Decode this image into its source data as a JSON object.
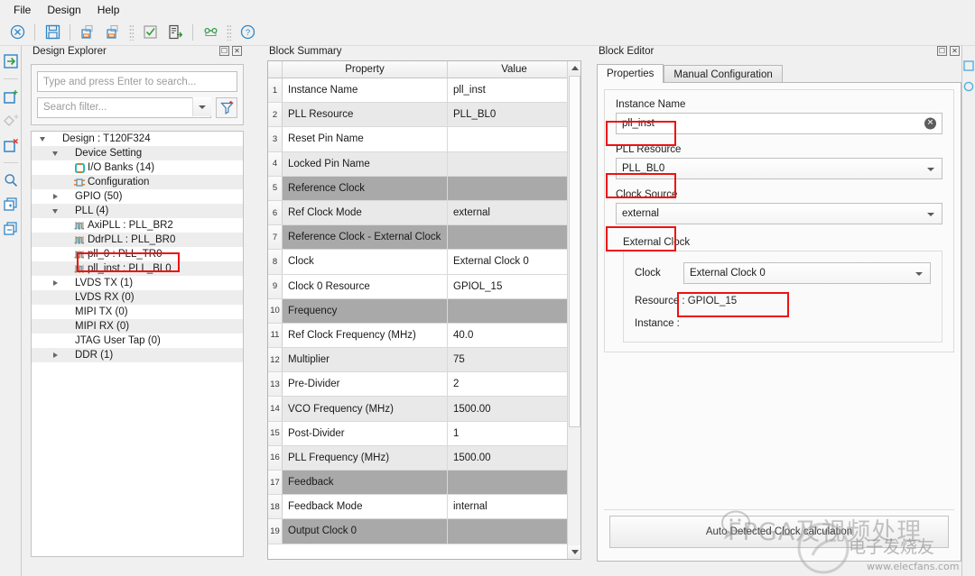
{
  "menubar": {
    "items": [
      "File",
      "Design",
      "Help"
    ]
  },
  "toolbar": {
    "buttons": [
      {
        "name": "close-design-icon",
        "glyph": "cancel"
      },
      {
        "name": "save-icon",
        "glyph": "save"
      },
      {
        "name": "import-design-icon",
        "glyph": "import"
      },
      {
        "name": "export-design-icon",
        "glyph": "export"
      },
      {
        "name": "check-design-icon",
        "glyph": "check"
      },
      {
        "name": "generate-report-icon",
        "glyph": "report"
      },
      {
        "name": "link-icon",
        "glyph": "link"
      },
      {
        "name": "help-icon",
        "glyph": "help"
      }
    ]
  },
  "rail": {
    "buttons": [
      {
        "name": "add-input-icon"
      },
      {
        "name": "add-block-icon"
      },
      {
        "name": "add-diamond-icon"
      },
      {
        "name": "remove-block-icon"
      },
      {
        "name": "search-icon"
      },
      {
        "name": "duplicate-add-icon"
      },
      {
        "name": "duplicate-icon"
      }
    ]
  },
  "explorer": {
    "title": "Design Explorer",
    "search_placeholder": "Type and press Enter to search...",
    "filter_placeholder": "Search filter...",
    "tree": [
      {
        "label": "Design : T120F324",
        "indent": 0,
        "twisty": "down",
        "icon": "none",
        "alt": false
      },
      {
        "label": "Device Setting",
        "indent": 1,
        "twisty": "down",
        "icon": "none",
        "alt": true
      },
      {
        "label": "I/O Banks (14)",
        "indent": 2,
        "twisty": "none",
        "icon": "iobank",
        "alt": false
      },
      {
        "label": "Configuration",
        "indent": 2,
        "twisty": "none",
        "icon": "config",
        "alt": true
      },
      {
        "label": "GPIO (50)",
        "indent": 1,
        "twisty": "right",
        "icon": "none",
        "alt": false
      },
      {
        "label": "PLL (4)",
        "indent": 1,
        "twisty": "down",
        "icon": "none",
        "alt": true
      },
      {
        "label": "AxiPLL : PLL_BR2",
        "indent": 2,
        "twisty": "none",
        "icon": "pll",
        "alt": false
      },
      {
        "label": "DdrPLL : PLL_BR0",
        "indent": 2,
        "twisty": "none",
        "icon": "pll",
        "alt": true
      },
      {
        "label": "pll_0 : PLL_TR0",
        "indent": 2,
        "twisty": "none",
        "icon": "pll",
        "alt": false
      },
      {
        "label": "pll_inst : PLL_BL0",
        "indent": 2,
        "twisty": "none",
        "icon": "pll",
        "alt": true
      },
      {
        "label": "LVDS TX (1)",
        "indent": 1,
        "twisty": "right",
        "icon": "none",
        "alt": false
      },
      {
        "label": "LVDS RX (0)",
        "indent": 1,
        "twisty": "none",
        "icon": "none",
        "alt": true
      },
      {
        "label": "MIPI TX (0)",
        "indent": 1,
        "twisty": "none",
        "icon": "none",
        "alt": false
      },
      {
        "label": "MIPI RX (0)",
        "indent": 1,
        "twisty": "none",
        "icon": "none",
        "alt": true
      },
      {
        "label": "JTAG User Tap (0)",
        "indent": 1,
        "twisty": "none",
        "icon": "none",
        "alt": false
      },
      {
        "label": "DDR (1)",
        "indent": 1,
        "twisty": "right",
        "icon": "none",
        "alt": true
      }
    ]
  },
  "summary": {
    "title": "Block Summary",
    "columns": [
      "",
      "Property",
      "Value"
    ],
    "rows": [
      {
        "n": "1",
        "property": "Instance Name",
        "value": "pll_inst",
        "style": "white"
      },
      {
        "n": "2",
        "property": "PLL Resource",
        "value": "PLL_BL0",
        "style": "light"
      },
      {
        "n": "3",
        "property": "Reset Pin Name",
        "value": "",
        "style": "white"
      },
      {
        "n": "4",
        "property": "Locked Pin Name",
        "value": "",
        "style": "light"
      },
      {
        "n": "5",
        "property": "Reference Clock",
        "value": "",
        "style": "dark"
      },
      {
        "n": "6",
        "property": "Ref Clock Mode",
        "value": "external",
        "style": "light"
      },
      {
        "n": "7",
        "property": "Reference Clock - External Clock",
        "value": "",
        "style": "dark"
      },
      {
        "n": "8",
        "property": "Clock",
        "value": "External Clock 0",
        "style": "white"
      },
      {
        "n": "9",
        "property": "Clock 0 Resource",
        "value": "GPIOL_15",
        "style": "white"
      },
      {
        "n": "10",
        "property": "Frequency",
        "value": "",
        "style": "dark"
      },
      {
        "n": "11",
        "property": "Ref Clock Frequency (MHz)",
        "value": "40.0",
        "style": "white"
      },
      {
        "n": "12",
        "property": "Multiplier",
        "value": "75",
        "style": "light"
      },
      {
        "n": "13",
        "property": "Pre-Divider",
        "value": "2",
        "style": "white"
      },
      {
        "n": "14",
        "property": "VCO Frequency (MHz)",
        "value": "1500.00",
        "style": "light"
      },
      {
        "n": "15",
        "property": "Post-Divider",
        "value": "1",
        "style": "white"
      },
      {
        "n": "16",
        "property": "PLL Frequency (MHz)",
        "value": "1500.00",
        "style": "light"
      },
      {
        "n": "17",
        "property": "Feedback",
        "value": "",
        "style": "dark"
      },
      {
        "n": "18",
        "property": "Feedback Mode",
        "value": "internal",
        "style": "white"
      },
      {
        "n": "19",
        "property": "Output Clock 0",
        "value": "",
        "style": "dark"
      }
    ]
  },
  "editor": {
    "title": "Block Editor",
    "tabs": [
      {
        "label": "Properties",
        "active": true
      },
      {
        "label": "Manual Configuration",
        "active": false
      }
    ],
    "instance_name_label": "Instance Name",
    "instance_name_value": "pll_inst",
    "pll_resource_label": "PLL Resource",
    "pll_resource_value": "PLL_BL0",
    "clock_source_label": "Clock Source",
    "clock_source_value": "external",
    "external_clock_legend": "External Clock",
    "clock_label": "Clock",
    "clock_value": "External Clock 0",
    "resource_line": "Resource :  GPIOL_15",
    "instance_line": "Instance :",
    "calculate_button": "Auto Detected Clock calculation"
  },
  "watermark": {
    "chinese": "FPGA及视频处理",
    "site": "电子发烧友",
    "url": "www.elecfans.com"
  },
  "colors": {
    "highlight": "#ee1111",
    "panel_bg": "#f0f0f0",
    "row_dark": "#a9a9a9",
    "row_light": "#e9e9e9"
  }
}
